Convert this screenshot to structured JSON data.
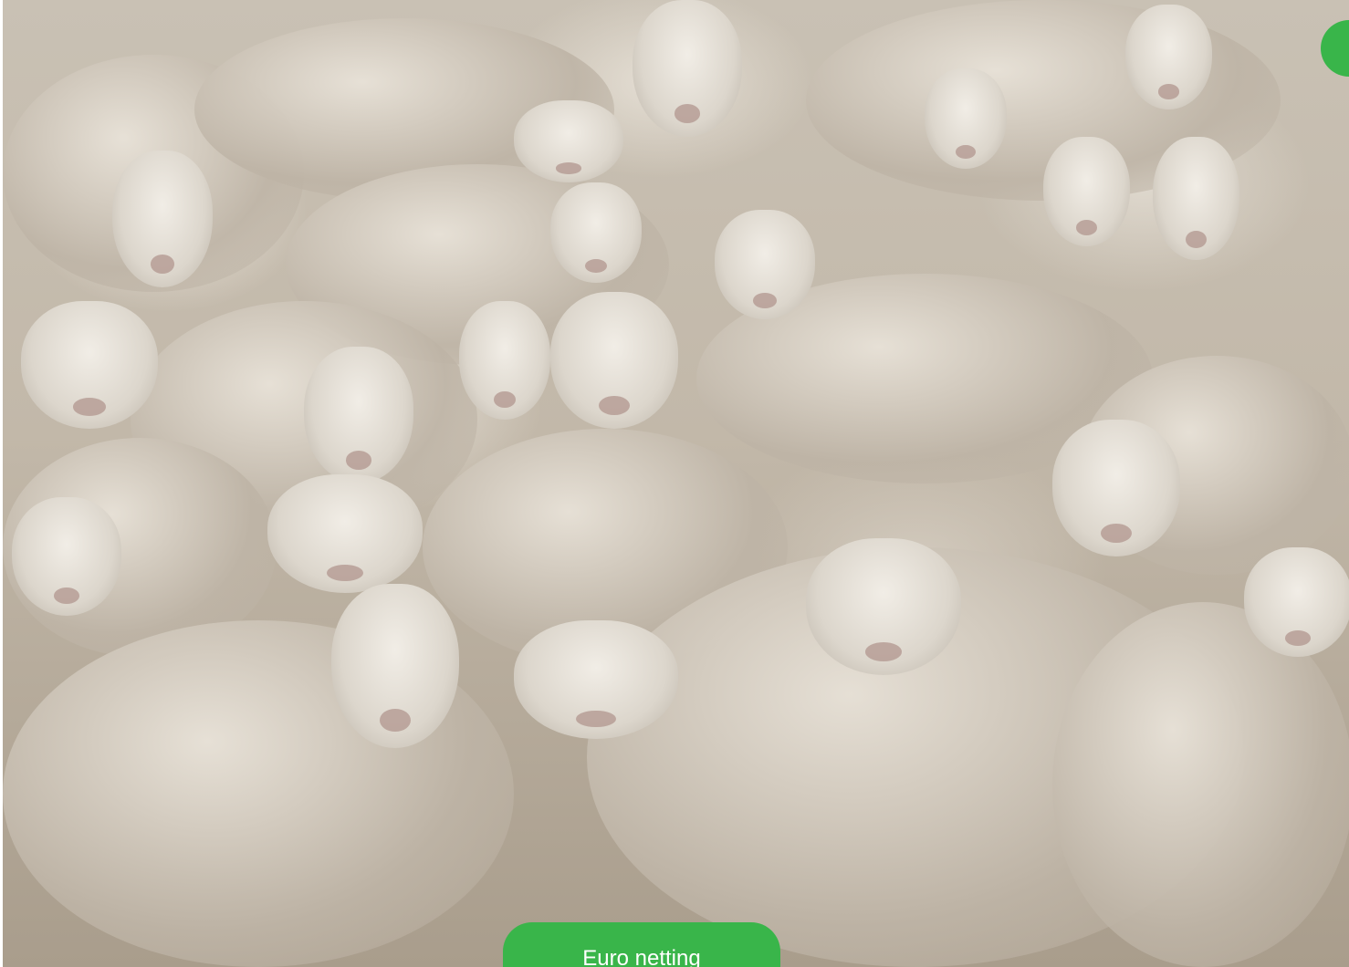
{
  "hero": {
    "image_icon": "sheep-flock-photo"
  },
  "cta": {
    "label": "Euro netting"
  },
  "colors": {
    "accent_green": "#39b54a",
    "wool": "#c9c1b4",
    "face": "#ede8e0"
  }
}
